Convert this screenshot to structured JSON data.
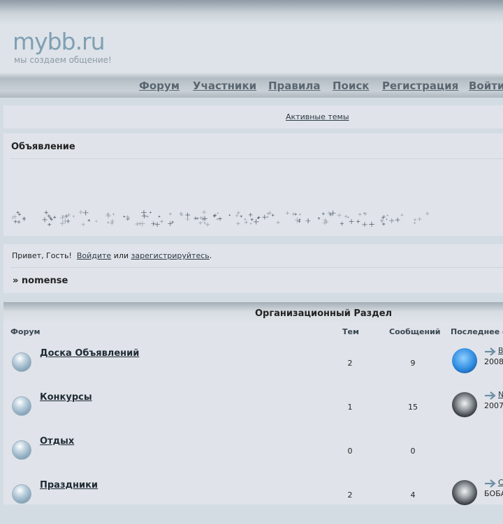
{
  "header": {
    "logo": "mybb.ru",
    "slogan": "мы создаем общение!",
    "nav": [
      "Форум",
      "Участники",
      "Правила",
      "Поиск",
      "Регистрация",
      "Войти"
    ]
  },
  "active_topics": "Активные темы",
  "announcement": {
    "title": "Объявление"
  },
  "greeting": {
    "prefix": "Привет, Гость!",
    "login": "Войдите",
    "or": "или",
    "register": "зарегистрируйтесь",
    "dot": "."
  },
  "breadcrumb": "» nomense",
  "section": {
    "title": "Организационный Раздел",
    "columns": [
      "Форум",
      "Тем",
      "Сообщений",
      "Последнее со"
    ],
    "rows": [
      {
        "name": "Доска Объявлений",
        "topics": "2",
        "posts": "9",
        "last_title": "В",
        "last_date": "2008",
        "avatar": "apple"
      },
      {
        "name": "Конкурсы",
        "topics": "1",
        "posts": "15",
        "last_title": "N",
        "last_date": "2007",
        "avatar": "dark"
      },
      {
        "name": "Отдых",
        "topics": "0",
        "posts": "0",
        "last_title": "",
        "last_date": "",
        "avatar": ""
      },
      {
        "name": "Праздники",
        "topics": "2",
        "posts": "4",
        "last_title": "С",
        "last_date": "БОБА",
        "avatar": "dark"
      }
    ]
  },
  "colors": {
    "accent": "#7f9fb4",
    "panel": "#e0e4ea",
    "background": "#d3dce2"
  }
}
